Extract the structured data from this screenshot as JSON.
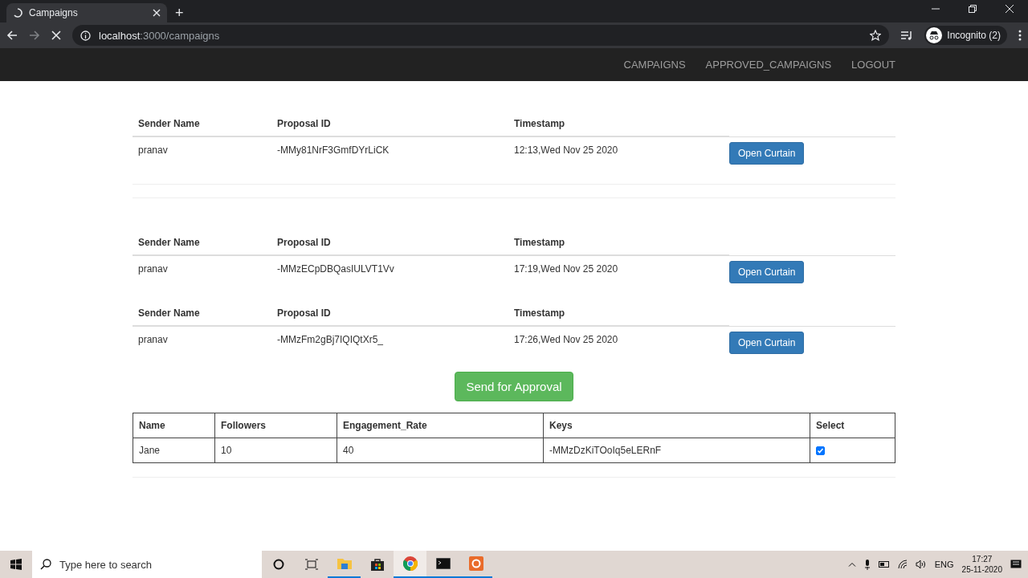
{
  "browser": {
    "tab": {
      "title": "Campaigns",
      "loading": true
    },
    "new_tab": "+",
    "address": {
      "host": "localhost",
      "path": ":3000/campaigns"
    },
    "profile": "Incognito (2)"
  },
  "navbar": {
    "links": [
      "CAMPAIGNS",
      "APPROVED_CAMPAIGNS",
      "LOGOUT"
    ]
  },
  "proposals": [
    {
      "columns": [
        "Sender Name",
        "Proposal ID",
        "Timestamp"
      ],
      "sender": "pranav",
      "proposal_id": "-MMy81NrF3GmfDYrLiCK",
      "timestamp": "12:13,Wed Nov 25 2020",
      "button": "Open Curtain"
    },
    {
      "columns": [
        "Sender Name",
        "Proposal ID",
        "Timestamp"
      ],
      "sender": "pranav",
      "proposal_id": "-MMzECpDBQasIULVT1Vv",
      "timestamp": "17:19,Wed Nov 25 2020",
      "button": "Open Curtain"
    },
    {
      "columns": [
        "Sender Name",
        "Proposal ID",
        "Timestamp"
      ],
      "sender": "pranav",
      "proposal_id": "-MMzFm2gBj7IQIQtXr5_",
      "timestamp": "17:26,Wed Nov 25 2020",
      "button": "Open Curtain"
    }
  ],
  "send_button": "Send for Approval",
  "influencers": {
    "columns": [
      "Name",
      "Followers",
      "Engagement_Rate",
      "Keys",
      "Select"
    ],
    "rows": [
      {
        "name": "Jane",
        "followers": "10",
        "engagement_rate": "40",
        "key": "-MMzDzKiTOoIq5eLERnF",
        "checked": true
      }
    ]
  },
  "taskbar": {
    "search_placeholder": "Type here to search",
    "language": "ENG",
    "time": "17:27",
    "date": "25-11-2020"
  }
}
